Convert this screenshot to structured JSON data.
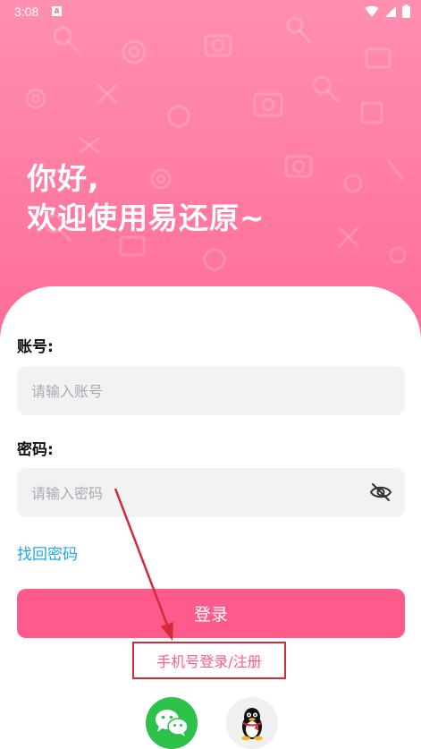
{
  "status_bar": {
    "time": "3:08",
    "notification_badge": "A"
  },
  "greeting": {
    "line1": "你好,",
    "line2": "欢迎使用易还原~"
  },
  "account": {
    "label": "账号:",
    "placeholder": "请输入账号",
    "value": ""
  },
  "password": {
    "label": "密码:",
    "placeholder": "请输入密码",
    "value": ""
  },
  "forgot_password": "找回密码",
  "login_button": "登录",
  "phone_login": "手机号登录/注册",
  "icons": {
    "wechat": "wechat-icon",
    "qq": "qq-penguin-icon",
    "eye": "eye-hidden-icon",
    "wifi": "wifi-icon",
    "signal": "signal-icon",
    "battery": "battery-icon"
  },
  "colors": {
    "brand_pink": "#ff5a8c",
    "link_blue": "#1ea6e8",
    "wechat_green": "#2cc24a",
    "annotation_red": "#d32b3a"
  }
}
